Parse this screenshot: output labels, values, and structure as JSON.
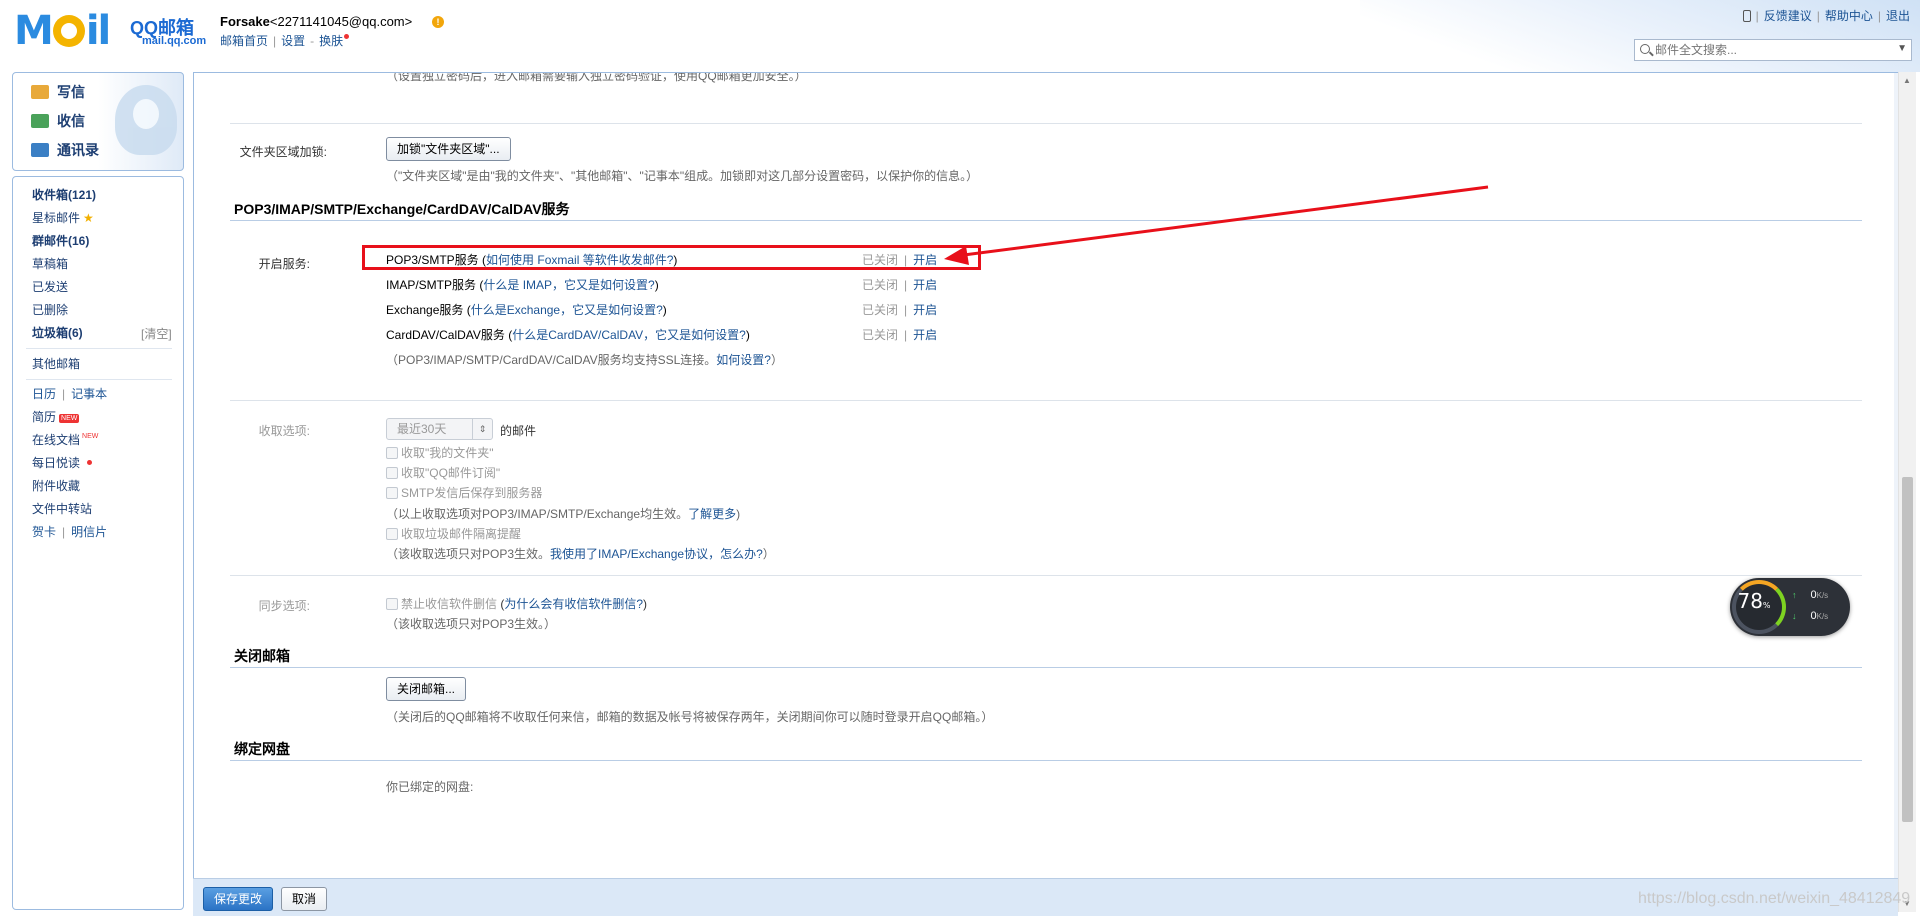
{
  "logo": {
    "mark": "MOil",
    "name": "QQ邮箱",
    "url": "mail.qq.com"
  },
  "user": {
    "name": "Forsake",
    "email": "<2271141045@qq.com>"
  },
  "header_links": [
    "邮箱首页",
    "设置",
    "换肤"
  ],
  "top_right": [
    "反馈建议",
    "帮助中心",
    "退出"
  ],
  "search": {
    "placeholder": "邮件全文搜索..."
  },
  "quick_actions": [
    {
      "label": "写信",
      "icon": "compose-icon"
    },
    {
      "label": "收信",
      "icon": "inbox-download-icon"
    },
    {
      "label": "通讯录",
      "icon": "contacts-icon"
    }
  ],
  "nav": {
    "inbox": "收件箱(121)",
    "starred": "星标邮件",
    "group": "群邮件(16)",
    "drafts": "草稿箱",
    "sent": "已发送",
    "deleted": "已删除",
    "spam": "垃圾箱(6)",
    "spam_clear": "[清空]",
    "other": "其他邮箱",
    "calendar": "日历",
    "notes": "记事本",
    "resume": "简历",
    "resume_tag": "NEW",
    "docs": "在线文档",
    "docs_tag": "NEW",
    "daily": "每日悦读",
    "attach": "附件收藏",
    "transfer": "文件中转站",
    "card": "贺卡",
    "postcard": "明信片"
  },
  "settings": {
    "pw_hint": "（设置独立密码后，进入邮箱需要输入独立密码验证，使用QQ邮箱更加安全。）",
    "folder_lock_label": "文件夹区域加锁:",
    "folder_lock_btn": "加锁\"文件夹区域\"...",
    "folder_lock_hint": "（\"文件夹区域\"是由\"我的文件夹\"、\"其他邮箱\"、\"记事本\"组成。加锁即对这几部分设置密码，以保护你的信息。）",
    "pop_title": "POP3/IMAP/SMTP/Exchange/CardDAV/CalDAV服务",
    "enable_label": "开启服务:",
    "services": [
      {
        "name": "POP3/SMTP服务",
        "help": "如何使用 Foxmail 等软件收发邮件?",
        "status": "已关闭",
        "action": "开启"
      },
      {
        "name": "IMAP/SMTP服务",
        "help": "什么是 IMAP，它又是如何设置?",
        "status": "已关闭",
        "action": "开启"
      },
      {
        "name": "Exchange服务",
        "help": "什么是Exchange，它又是如何设置?",
        "status": "已关闭",
        "action": "开启"
      },
      {
        "name": "CardDAV/CalDAV服务",
        "help": "什么是CardDAV/CalDAV，它又是如何设置?",
        "status": "已关闭",
        "action": "开启"
      }
    ],
    "ssl_hint": "（POP3/IMAP/SMTP/CardDAV/CalDAV服务均支持SSL连接。",
    "ssl_link": "如何设置?",
    "recv_label": "收取选项:",
    "recv_range": "最近30天",
    "recv_suffix": "的邮件",
    "recv_opts": [
      "收取\"我的文件夹\"",
      "收取\"QQ邮件订阅\"",
      "SMTP发信后保存到服务器"
    ],
    "recv_hint": "（以上收取选项对POP3/IMAP/SMTP/Exchange均生效。",
    "recv_more": "了解更多",
    "spam_opt": "收取垃圾邮件隔离提醒",
    "spam_hint": "（该收取选项只对POP3生效。",
    "spam_link": "我使用了IMAP/Exchange协议，怎么办?",
    "sync_label": "同步选项:",
    "sync_opt": "禁止收信软件删信",
    "sync_link": "为什么会有收信软件删信?",
    "sync_hint": "（该收取选项只对POP3生效。）",
    "close_title": "关闭邮箱",
    "close_btn": "关闭邮箱...",
    "close_hint": "（关闭后的QQ邮箱将不收取任何来信，邮箱的数据及帐号将被保存两年，关闭期间你可以随时登录开启QQ邮箱。）",
    "disk_title": "绑定网盘",
    "disk_hint": "你已绑定的网盘:"
  },
  "footer": {
    "save": "保存更改",
    "cancel": "取消"
  },
  "speed": {
    "percent": "78",
    "unit": "%",
    "up": "0",
    "down": "0",
    "rate_unit": "K/s"
  },
  "watermark": "https://blog.csdn.net/weixin_48412849",
  "colors": {
    "accent": "#1d5494",
    "highlight": "#e8101a",
    "save_bg": "#2b73c5"
  }
}
